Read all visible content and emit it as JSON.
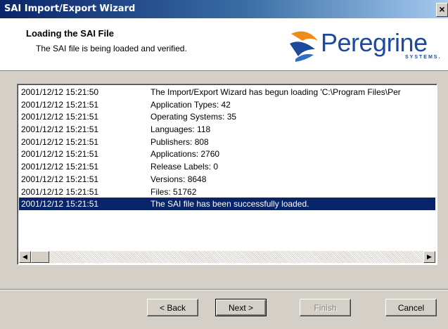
{
  "window": {
    "title": "SAI Import/Export Wizard",
    "close_glyph": "×"
  },
  "header": {
    "title": "Loading the SAI File",
    "subtitle": "The SAI file is being loaded and verified.",
    "logo_text": "Peregrine",
    "logo_sub": "SYSTEMS."
  },
  "log": {
    "rows": [
      {
        "time": "2001/12/12 15:21:50",
        "message": "The Import/Export Wizard has begun loading 'C:\\Program Files\\Per"
      },
      {
        "time": "2001/12/12 15:21:51",
        "message": "Application Types: 42"
      },
      {
        "time": "2001/12/12 15:21:51",
        "message": "Operating Systems: 35"
      },
      {
        "time": "2001/12/12 15:21:51",
        "message": "Languages: 118"
      },
      {
        "time": "2001/12/12 15:21:51",
        "message": "Publishers: 808"
      },
      {
        "time": "2001/12/12 15:21:51",
        "message": "Applications: 2760"
      },
      {
        "time": "2001/12/12 15:21:51",
        "message": "Release Labels: 0"
      },
      {
        "time": "2001/12/12 15:21:51",
        "message": "Versions: 8648"
      },
      {
        "time": "2001/12/12 15:21:51",
        "message": "Files: 51762"
      },
      {
        "time": "2001/12/12 15:21:51",
        "message": "The SAI file has been successfully loaded.",
        "selected": true
      }
    ],
    "scroll_left": "◀",
    "scroll_right": "▶"
  },
  "buttons": {
    "back": "< Back",
    "next": "Next >",
    "finish": "Finish",
    "cancel": "Cancel"
  },
  "colors": {
    "selection": "#0a246a",
    "titlebar": "#0a246a",
    "logo": "#1e4a9c"
  }
}
